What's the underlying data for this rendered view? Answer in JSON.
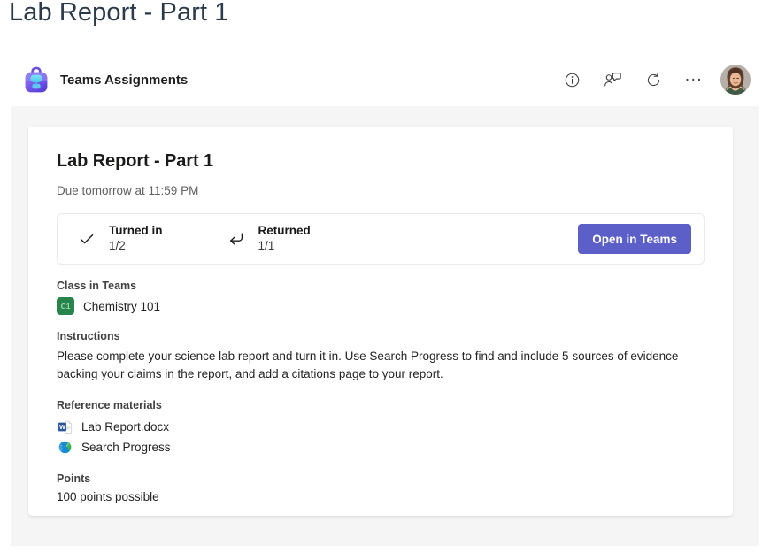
{
  "page": {
    "title": "Lab Report - Part 1"
  },
  "header": {
    "app_name": "Teams Assignments",
    "app_icon": "backpack-icon",
    "actions": [
      {
        "name": "info-icon",
        "label": "Info"
      },
      {
        "name": "people-chat-icon",
        "label": "Chat with people"
      },
      {
        "name": "refresh-icon",
        "label": "Refresh"
      },
      {
        "name": "more-options-icon",
        "label": "..."
      }
    ],
    "avatar": {
      "name": "user-avatar",
      "label": "Account manager"
    }
  },
  "assignment": {
    "title": "Lab Report - Part 1",
    "due": "Due tomorrow at 11:59 PM",
    "status": {
      "turned_in": {
        "label": "Turned in",
        "value": "1/2",
        "icon": "checkmark-icon"
      },
      "returned": {
        "label": "Returned",
        "value": "1/1",
        "icon": "return-arrow-icon"
      },
      "open_button": "Open in Teams"
    },
    "class_section": {
      "heading": "Class in Teams",
      "team_initials": "C1",
      "team_name": "Chemistry 101"
    },
    "instructions_section": {
      "heading": "Instructions",
      "text": "Please complete your science lab report and turn it in. Use Search Progress to find and include 5 sources of evidence backing your claims in the report, and add a citations page to your report."
    },
    "reference_section": {
      "heading": "Reference materials",
      "items": [
        {
          "name": "Lab Report.docx",
          "icon": "word-document-icon"
        },
        {
          "name": "Search Progress",
          "icon": "globe-icon"
        }
      ]
    },
    "points_section": {
      "heading": "Points",
      "value": "100 points possible"
    }
  },
  "colors": {
    "teams_purple": "#5b5fc7",
    "stage_gray": "#f5f5f5",
    "team_green": "#27844a",
    "title_slate": "#2b3a4a"
  }
}
